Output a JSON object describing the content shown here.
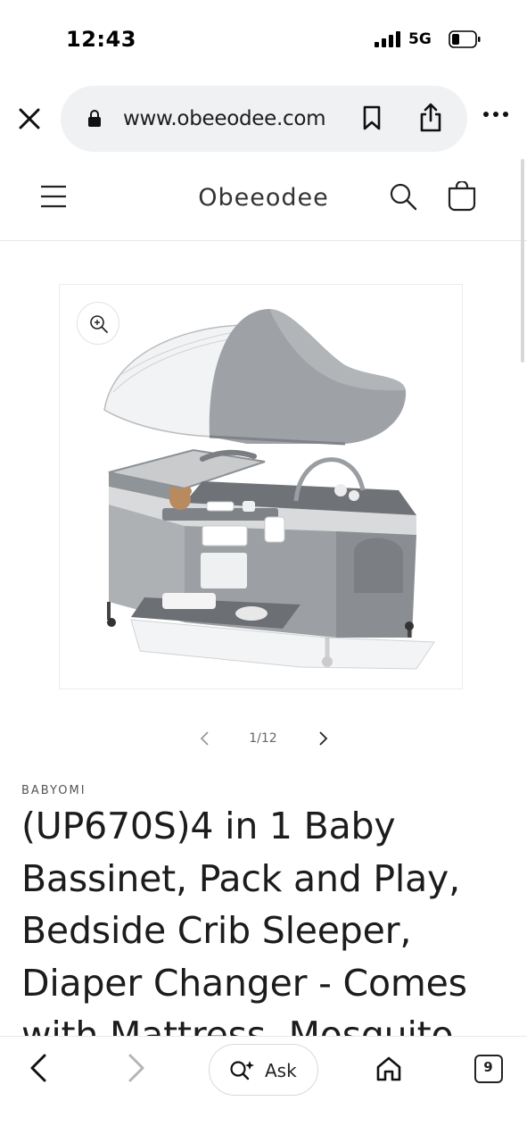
{
  "status_bar": {
    "time": "12:43",
    "network": "5G",
    "network_icon": "signal-bars-icon",
    "battery_icon": "battery-icon"
  },
  "browser": {
    "url": "www.obeeodee.com",
    "close_icon": "close-icon",
    "lock_icon": "lock-icon",
    "bookmark_icon": "bookmark-icon",
    "share_icon": "share-icon",
    "more_icon": "more-icon"
  },
  "site_header": {
    "logo": "Obeeodee",
    "menu_icon": "hamburger-menu-icon",
    "search_icon": "search-icon",
    "cart_icon": "cart-icon"
  },
  "product": {
    "image_alt": "Baby bassinet pack and play with canopy",
    "zoom_icon": "zoom-in-icon",
    "pager": {
      "current": "1/12",
      "prev_icon": "chevron-left-icon",
      "next_icon": "chevron-right-icon"
    },
    "vendor": "BABYOMI",
    "title": "(UP670S)4 in 1 Baby Bassinet, Pack and Play, Bedside Crib Sleeper, Diaper Changer - Comes with Mattress, Mosquito"
  },
  "bottom_bar": {
    "back_icon": "back-arrow-icon",
    "forward_icon": "forward-arrow-icon",
    "ask_label": "Ask",
    "ask_icon": "ask-sparkle-icon",
    "home_icon": "home-icon",
    "tabs_count": "9"
  },
  "colors": {
    "url_pill": "#eff1f3",
    "product_gray": "#8f9499",
    "text": "#1c1c1c",
    "muted": "#666666"
  }
}
